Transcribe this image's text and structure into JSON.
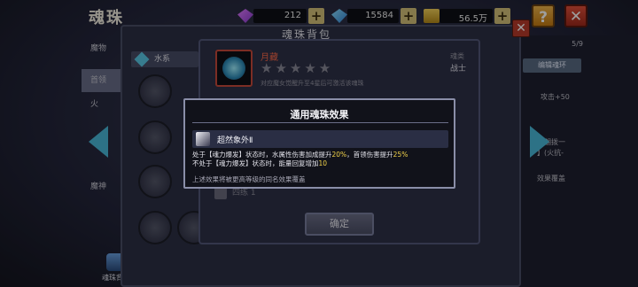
{
  "header": {
    "title": "魂珠",
    "resources": [
      {
        "icon": "purple-gem-icon",
        "value": "212"
      },
      {
        "icon": "blue-gem-icon",
        "value": "15584"
      },
      {
        "icon": "gold-coin-icon",
        "value": "56.5万"
      }
    ],
    "plus_label": "+",
    "help_label": "?",
    "close_label": "✕"
  },
  "side_menu": {
    "items": [
      "魔物",
      "首领",
      "火",
      "魔神"
    ],
    "bag_label": "魂珠背包"
  },
  "bag_panel": {
    "title": "魂珠背包",
    "filter": "水系",
    "close_label": "✕"
  },
  "right_panel": {
    "count": "5/9",
    "button": "编辑魂环",
    "text_a": "攻击+50",
    "text_b": "合翩拨一",
    "text_c": "】(火抗-",
    "text_d": "效果覆盖"
  },
  "detail": {
    "name": "月藏",
    "stars": "★★★★★",
    "desc": "对应魔女觉醒升至4星后可激活该魂珠",
    "type_label": "魂类",
    "type_value": "战士",
    "footer": "四练 1",
    "confirm": "确定"
  },
  "popup": {
    "title": "通用魂珠效果",
    "effect_name": "超然象外Ⅱ",
    "line1_a": "处于【魂力爆发】状态时，水属性伤害加成提升",
    "line1_b": "20%",
    "line1_c": "，首领伤害提升",
    "line1_d": "25%",
    "line2_a": "不处于【魂力爆发】状态时，能量回复增加",
    "line2_b": "10",
    "note": "上述效果将被更高等级的同名效果覆盖"
  }
}
